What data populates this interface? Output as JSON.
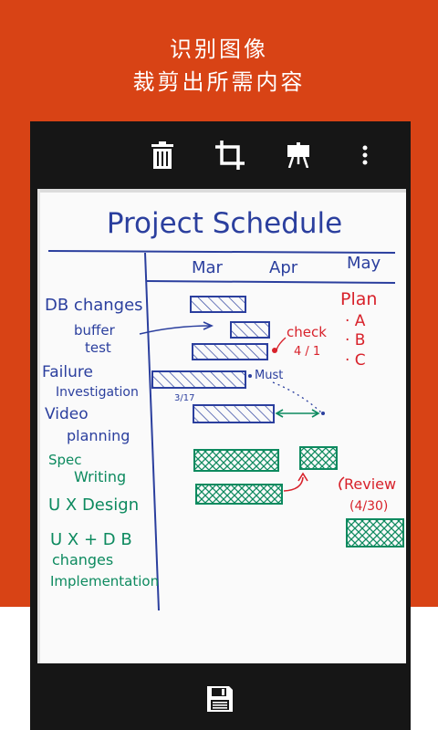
{
  "colors": {
    "banner": "#d84315",
    "phone_chrome": "#161616",
    "board": "#fafafa",
    "ink_blue": "#2b3f9e",
    "ink_red": "#d8222b",
    "ink_green": "#0d8a5f"
  },
  "banner": {
    "line1": "识别图像",
    "line2": "裁剪出所需内容"
  },
  "toolbar": {
    "icons": [
      "trash-icon",
      "crop-icon",
      "easel-icon",
      "more-vert-icon"
    ]
  },
  "bottom_bar": {
    "icons": [
      "save-icon"
    ]
  },
  "board": {
    "title": "Project Schedule",
    "months": [
      "Mar",
      "Apr",
      "May"
    ],
    "tasks": [
      "DB changes",
      "buffer",
      "test",
      "Failure",
      "Investigation",
      "Video",
      "planning"
    ],
    "green_tasks": [
      "Spec",
      "Writing",
      "U X Design",
      "U X + D B",
      "changes",
      "Implementation"
    ],
    "notes": {
      "check": "check",
      "check_date": "4 / 1",
      "must": "Must",
      "date_317": "3/17",
      "review": "Review",
      "review_date": "(4/30)"
    },
    "plan": {
      "title": "Plan",
      "items": [
        "· A",
        "· B",
        "· C"
      ]
    }
  }
}
